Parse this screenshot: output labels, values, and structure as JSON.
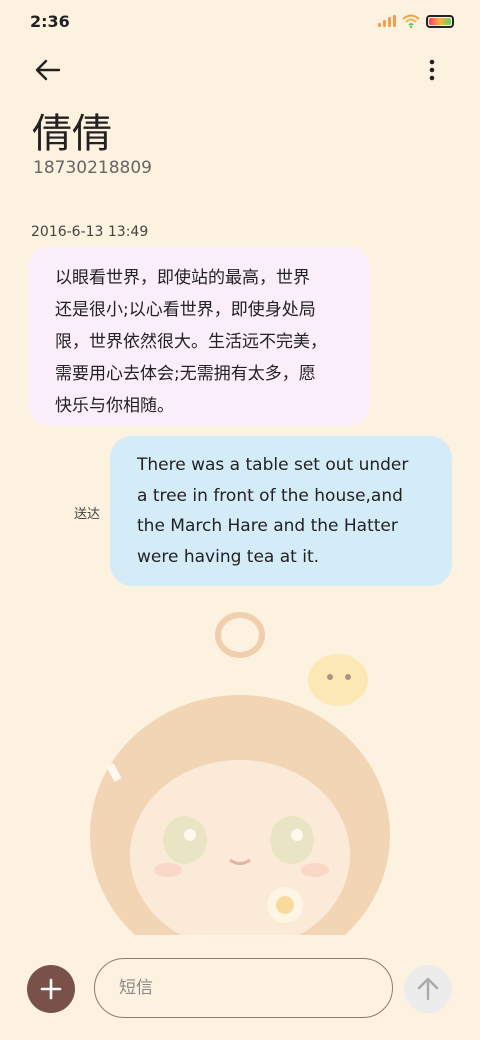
{
  "status_bar": {
    "time": "2:36"
  },
  "contact": {
    "name": "倩倩",
    "number": "18730218809"
  },
  "conversation": {
    "timestamp": "2016-6-13 13:49",
    "incoming": {
      "lines": [
        "以眼看世界，即使站的最高，世界",
        "还是很小;以心看世界，即使身处局",
        "限，世界依然很大。生活远不完美，",
        "需要用心去体会;无需拥有太多，愿",
        "快乐与你相随。"
      ]
    },
    "outgoing": {
      "status": "送达",
      "lines": [
        "There was a table set out under",
        "a tree in front of the house,and",
        "the March Hare and the Hatter",
        "were having tea at it."
      ]
    }
  },
  "composer": {
    "placeholder": "短信"
  },
  "icons": {
    "back": "back-arrow-icon",
    "menu": "more-vertical-icon",
    "add": "plus-icon",
    "send": "arrow-up-icon"
  },
  "colors": {
    "background": "#fdf2e0",
    "incoming_bubble": "#fbeefb",
    "outgoing_bubble": "#d4ecf8",
    "add_button": "#7a5148",
    "send_button": "#ececec"
  }
}
